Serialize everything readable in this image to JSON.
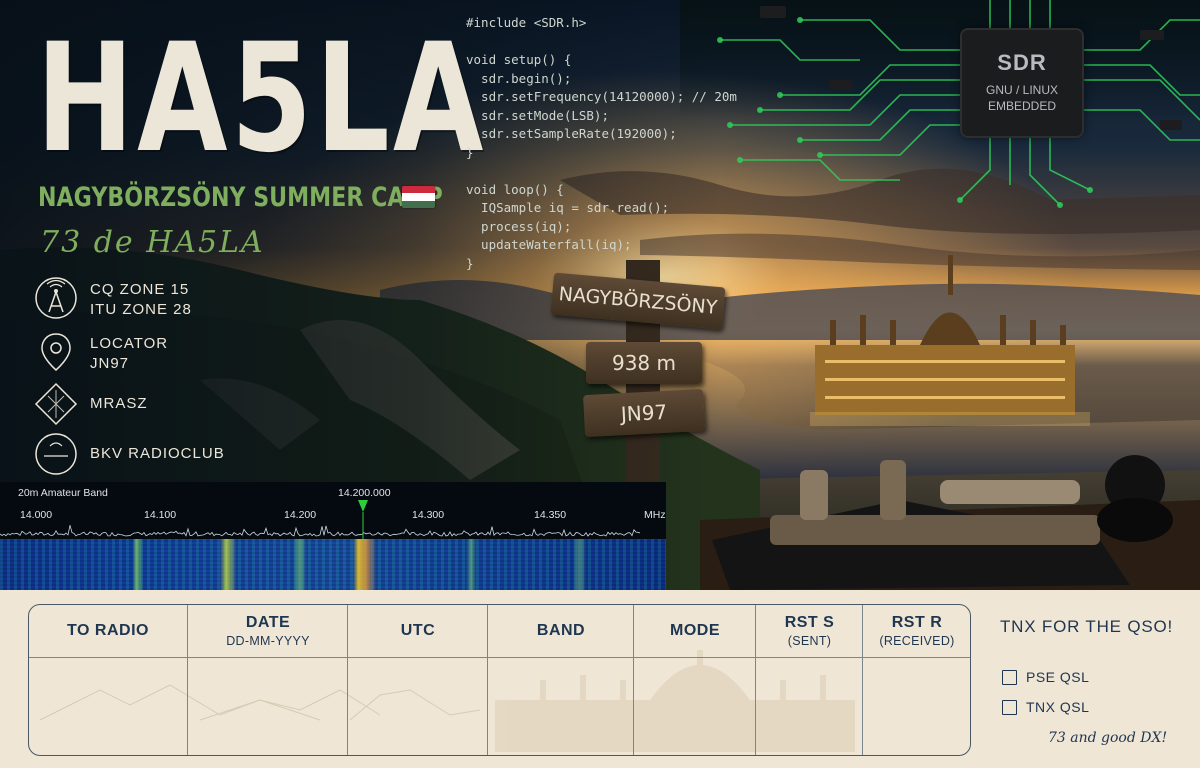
{
  "card": {
    "callsign": "HA5LA",
    "event": "NAGYBÖRZSÖNY SUMMER CAMP",
    "flag_icon": "hungary-flag-icon",
    "flag_colors": [
      "#cd2a3e",
      "#ffffff",
      "#436f4d"
    ],
    "greeting": "73 de HA5LA",
    "accent_green": "#7fae5e",
    "ink_color": "#1f3650"
  },
  "info": [
    {
      "icon": "radio-tower-icon",
      "line1": "CQ ZONE 15",
      "line2": "ITU ZONE 28"
    },
    {
      "icon": "location-pin-icon",
      "line1": "LOCATOR",
      "line2": "JN97"
    },
    {
      "icon": "mrasz-logo-icon",
      "line1": "MRASZ",
      "line2": ""
    },
    {
      "icon": "bkv-logo-icon",
      "line1": "BKV RADIOCLUB",
      "line2": ""
    }
  ],
  "code": {
    "lines": [
      "#include <SDR.h>",
      "",
      "void setup() {",
      "  sdr.begin();",
      "  sdr.setFrequency(14120000); // 20m",
      "  sdr.setMode(LSB);",
      "  sdr.setSampleRate(192000);",
      "}",
      "",
      "void loop() {",
      "  IQSample iq = sdr.read();",
      "  process(iq);",
      "  updateWaterfall(iq);",
      "}"
    ]
  },
  "chip": {
    "label": "SDR",
    "line1": "GNU / LINUX",
    "line2": "EMBEDDED"
  },
  "signpost": {
    "top": "NAGYBÖRZSÖNY",
    "middle": "938 m",
    "bottom": "JN97"
  },
  "waterfall": {
    "title": "20m Amateur Band",
    "center_frequency": "14.200.000",
    "ticks": [
      "14.000",
      "14.100",
      "14.200",
      "14.300",
      "14.350"
    ],
    "unit": "MHz",
    "marker_color": "#2ecc40"
  },
  "log": {
    "columns": [
      {
        "label": "TO RADIO",
        "sub": ""
      },
      {
        "label": "DATE",
        "sub": "DD-MM-YYYY"
      },
      {
        "label": "UTC",
        "sub": ""
      },
      {
        "label": "BAND",
        "sub": ""
      },
      {
        "label": "MODE",
        "sub": ""
      },
      {
        "label": "RST S",
        "sub": "(SENT)"
      },
      {
        "label": "RST R",
        "sub": "(RECEIVED)"
      }
    ]
  },
  "qsl": {
    "thanks": "TNX FOR THE QSO!",
    "pse_label": "PSE QSL",
    "tnx_label": "TNX QSL",
    "signoff": "73 and good DX!"
  }
}
